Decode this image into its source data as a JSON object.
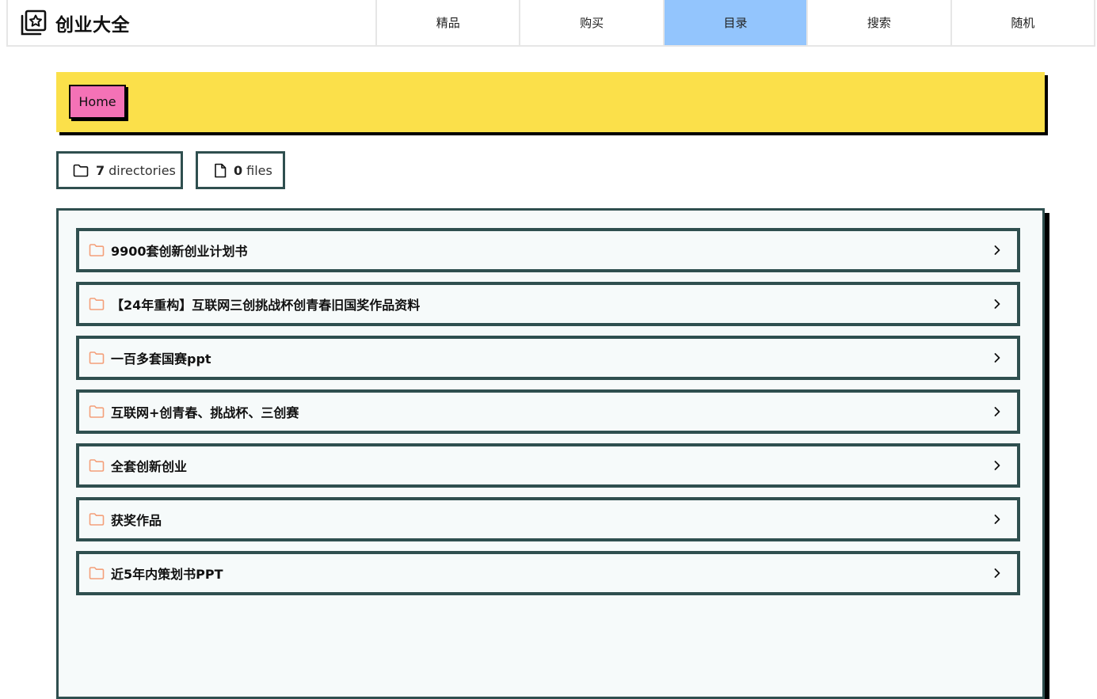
{
  "app": {
    "brand_title": "创业大全",
    "brand_icon": "star-folder-icon"
  },
  "nav": {
    "items": [
      {
        "label": "精品"
      },
      {
        "label": "购买"
      },
      {
        "label": "目录",
        "active": true
      },
      {
        "label": "搜索"
      },
      {
        "label": "随机"
      }
    ]
  },
  "breadcrumb": {
    "home_label": "Home"
  },
  "stats": {
    "directories_count": "7",
    "directories_label": "directories",
    "files_count": "0",
    "files_label": "files"
  },
  "listing": {
    "items": [
      {
        "label": "9900套创新创业计划书",
        "icon": "folder-icon"
      },
      {
        "label": "【24年重构】互联网三创挑战杯创青春旧国奖作品资料",
        "icon": "folder-icon"
      },
      {
        "label": "一百多套国赛ppt",
        "icon": "folder-icon"
      },
      {
        "label": "互联网+创青春、挑战杯、三创赛",
        "icon": "folder-icon"
      },
      {
        "label": "全套创新创业",
        "icon": "folder-icon"
      },
      {
        "label": "获奖作品",
        "icon": "folder-icon"
      },
      {
        "label": "近5年内策划书PPT",
        "icon": "folder-icon"
      }
    ]
  },
  "colors": {
    "nav_active": "#93c5fd",
    "breadcrumb_bg": "#fbe04a",
    "home_chip": "#f472b6",
    "border": "#2f4f4f",
    "folder_icon": "#f4a07a"
  }
}
